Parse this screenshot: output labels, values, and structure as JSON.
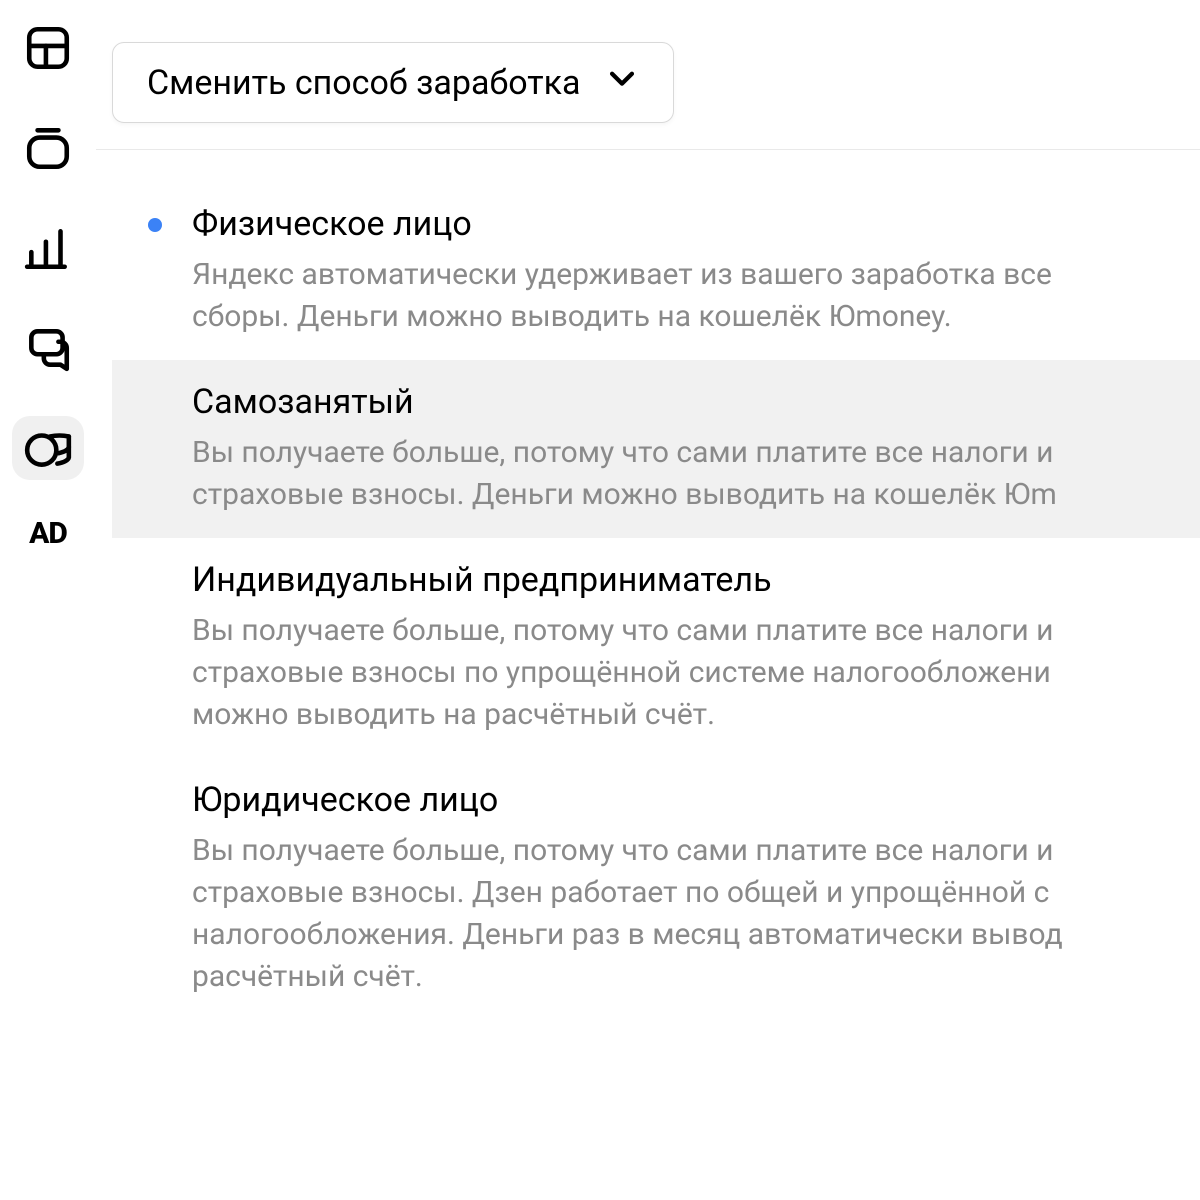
{
  "dropdown": {
    "label": "Сменить способ заработка"
  },
  "options": [
    {
      "title": "Физическое лицо",
      "desc": "Яндекс автоматически удерживает из вашего заработка все\nсборы. Деньги можно выводить на кошелёк Юmoney.",
      "selected": true,
      "highlighted": false
    },
    {
      "title": "Самозанятый",
      "desc": "Вы получаете больше, потому что сами платите все налоги и\nстраховые взносы. Деньги можно выводить на кошелёк Юm",
      "selected": false,
      "highlighted": true
    },
    {
      "title": "Индивидуальный предприниматель",
      "desc": "Вы получаете больше, потому что сами платите все налоги и\nстраховые взносы по упрощённой системе налогообложени\nможно выводить на расчётный счёт.",
      "selected": false,
      "highlighted": false
    },
    {
      "title": "Юридическое лицо",
      "desc": "Вы получаете больше, потому что сами платите все налоги и\nстраховые взносы. Дзен работает по общей и упрощённой с\nналогообложения. Деньги раз в месяц автоматически вывод\nрасчётный счёт.",
      "selected": false,
      "highlighted": false
    }
  ],
  "sidebar": {
    "ad_label": "AD"
  }
}
